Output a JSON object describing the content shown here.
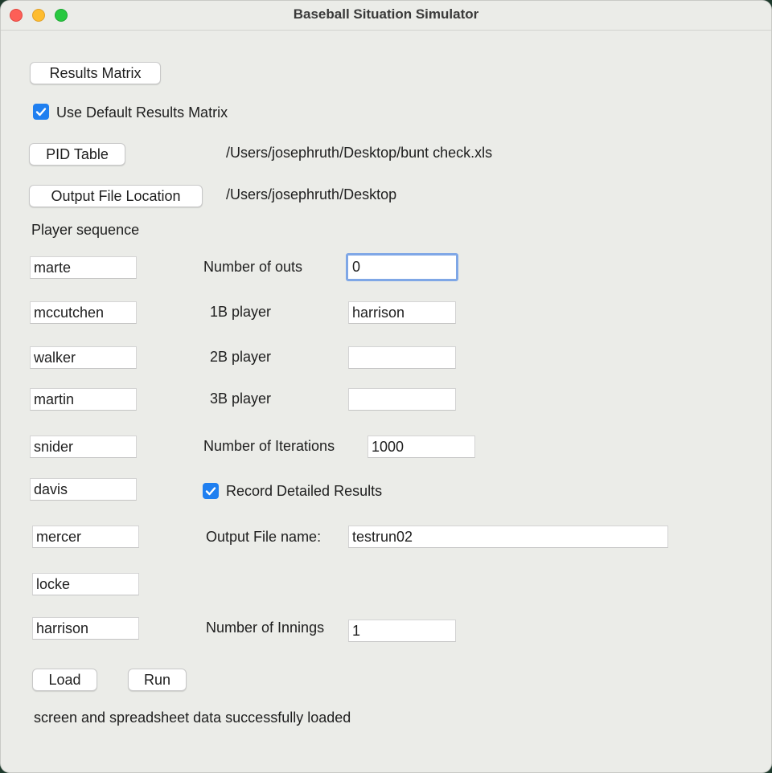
{
  "window": {
    "title": "Baseball Situation Simulator"
  },
  "buttons": {
    "results_matrix": "Results Matrix",
    "pid_table": "PID Table",
    "output_location": "Output File Location",
    "load": "Load",
    "run": "Run"
  },
  "checkboxes": {
    "use_default": {
      "label": "Use Default Results Matrix",
      "checked": true
    },
    "record_detailed": {
      "label": "Record Detailed Results",
      "checked": true
    }
  },
  "paths": {
    "pid_table": "/Users/josephruth/Desktop/bunt check.xls",
    "output_location": "/Users/josephruth/Desktop"
  },
  "player_sequence": {
    "label": "Player sequence",
    "players": [
      "marte",
      "mccutchen",
      "walker",
      "martin",
      "snider",
      "davis",
      "mercer",
      "locke",
      "harrison"
    ]
  },
  "form": {
    "outs": {
      "label": "Number of outs",
      "value": "0"
    },
    "first_base": {
      "label": "1B player",
      "value": "harrison"
    },
    "second_base": {
      "label": "2B player",
      "value": ""
    },
    "third_base": {
      "label": "3B player",
      "value": ""
    },
    "iterations": {
      "label": "Number of Iterations",
      "value": "1000"
    },
    "output_name": {
      "label": "Output File name:",
      "value": "testrun02"
    },
    "innings": {
      "label": "Number of Innings",
      "value": "1"
    }
  },
  "status": {
    "message": "screen and spreadsheet data successfully loaded"
  },
  "colors": {
    "accent": "#1f7ff0",
    "focus_ring": "#7fa7e6",
    "window_bg": "#ebece8"
  }
}
